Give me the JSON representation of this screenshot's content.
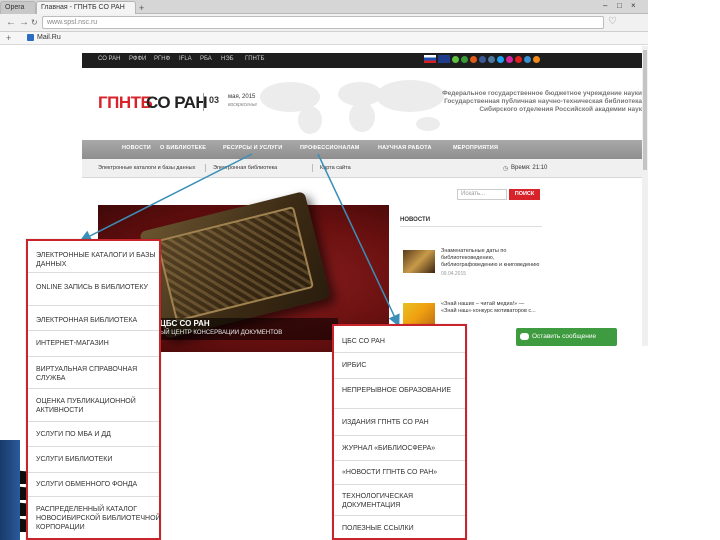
{
  "browser": {
    "opera_tab_label": "Opera",
    "tab_title": "Главная - ГПНТБ СО РАН",
    "new_tab_label": "+",
    "window_controls": [
      "–",
      "□",
      "×"
    ],
    "url": "www.spsl.nsc.ru",
    "bookmark_label": "Mail.Ru"
  },
  "site": {
    "top_links": [
      "СО РАН",
      "РФФИ",
      "РГНФ",
      "IFLA",
      "РБА",
      "НЭБ",
      "ГПНТБ"
    ],
    "logo_red": "ГПНТБ",
    "logo_black": "СО РАН",
    "date_day": "03",
    "date_month": "мая, 2015",
    "date_weekday": "воскресенье",
    "header_text": [
      "Федеральное государственное бюджетное учреждение науки",
      "Государственная публичная научно-техническая библиотека",
      "Сибирского отделения Российской академии наук"
    ],
    "main_nav": [
      "НОВОСТИ",
      "О БИБЛИОТЕКЕ",
      "РЕСУРСЫ И УСЛУГИ",
      "ПРОФЕССИОНАЛАМ",
      "НАУЧНАЯ РАБОТА",
      "МЕРОПРИЯТИЯ"
    ],
    "sub_nav": [
      "Электронные каталоги и базы данных",
      "Электронная библиотека",
      "Карта сайта"
    ],
    "clock": "Время: 21:10",
    "search_placeholder": "Искать...",
    "search_button": "ПОИСК",
    "news_heading": "НОВОСТИ",
    "news": [
      {
        "text": "Знаменательные даты по библиотековедению, библиографоведению и книговедению",
        "date": "09.04.2015"
      },
      {
        "text": "«Знай наших – читай медиа!» — «Знай наш» конкурс мотиваторов с...",
        "date": ""
      }
    ],
    "hero_title": "ЦБС СО РАН",
    "hero_subtitle": "ЫЙ ЦЕНТР КОНСЕРВАЦИИ ДОКУМЕНТОВ",
    "message_button": "Оставить сообщение"
  },
  "left_menu": {
    "items": [
      "ЭЛЕКТРОННЫЕ КАТАЛОГИ И БАЗЫ ДАННЫХ",
      "ONLINE ЗАПИСЬ В БИБЛИОТЕКУ",
      "ЭЛЕКТРОННАЯ БИБЛИОТЕКА",
      "ИНТЕРНЕТ-МАГАЗИН",
      "ВИРТУАЛЬНАЯ СПРАВОЧНАЯ СЛУЖБА",
      "ОЦЕНКА ПУБЛИКАЦИОННОЙ АКТИВНОСТИ",
      "УСЛУГИ ПО МБА И ДД",
      "УСЛУГИ БИБЛИОТЕКИ",
      "УСЛУГИ ОБМЕННОГО ФОНДА",
      "РАСПРЕДЕЛЕННЫЙ КАТАЛОГ НОВОСИБИРСКОЙ БИБЛИОТЕЧНОЙ КОРПОРАЦИИ"
    ]
  },
  "right_menu": {
    "items": [
      "ЦБС СО РАН",
      "ИРБИС",
      "НЕПРЕРЫВНОЕ ОБРАЗОВАНИЕ",
      "ИЗДАНИЯ ГПНТБ СО РАН",
      "ЖУРНАЛ «БИБЛИОСФЕРА»",
      "«НОВОСТИ ГПНТБ СО РАН»",
      "ТЕХНОЛОГИЧЕСКАЯ ДОКУМЕНТАЦИЯ",
      "ПОЛЕЗНЫЕ ССЫЛКИ"
    ]
  },
  "colors": {
    "accent_red": "#d8232a",
    "panel_border": "#c9232b",
    "arrow": "#3a8fb8",
    "message_green": "#3f9b3f"
  }
}
